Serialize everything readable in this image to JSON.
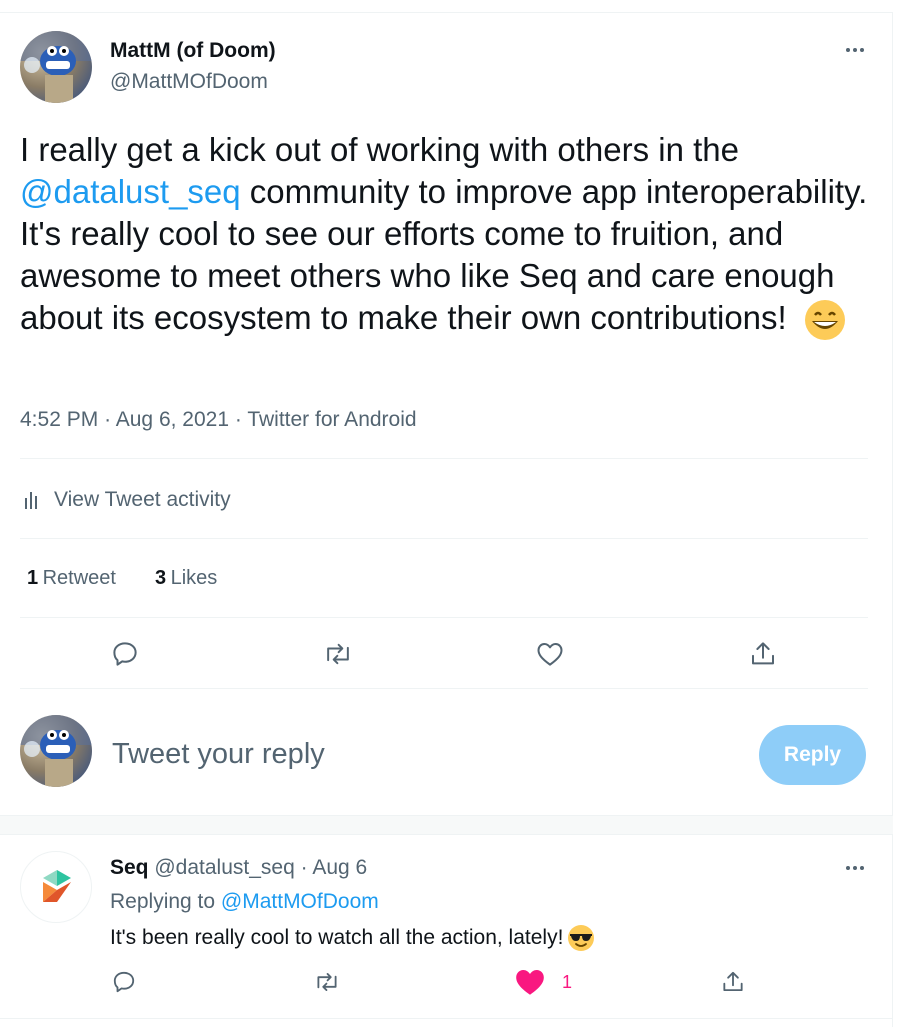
{
  "tweet": {
    "author_name": "MattM (of Doom)",
    "author_handle": "@MattMOfDoom",
    "text_before": "I really get a kick out of working with others in the ",
    "mention": "@datalust_seq",
    "text_after": " community to improve app interoperability. It's really cool to see our efforts come to fruition, and awesome to meet others who like Seq and care enough about its ecosystem to make their own contributions!",
    "emoji": "grinning-face-emoji",
    "time": "4:52 PM",
    "date": "Aug 6, 2021",
    "source": "Twitter for Android",
    "sep": "·"
  },
  "activity": {
    "label": "View Tweet activity"
  },
  "stats": {
    "retweets_count": "1",
    "retweets_label": "Retweet",
    "likes_count": "3",
    "likes_label": "Likes"
  },
  "composer": {
    "placeholder": "Tweet your reply",
    "button_label": "Reply"
  },
  "reply": {
    "author_name": "Seq",
    "author_handle": "@datalust_seq",
    "sep": "·",
    "date": "Aug 6",
    "replying_prefix": "Replying to ",
    "replying_to": "@MattMOfDoom",
    "text": "It's been really cool to watch all the action, lately! ",
    "emoji": "sunglasses-face-emoji",
    "like_count": "1"
  },
  "colors": {
    "accent": "#1d9bf0",
    "reply_button": "#8ecdf8",
    "like_active": "#f91880",
    "secondary_text": "#536471"
  }
}
